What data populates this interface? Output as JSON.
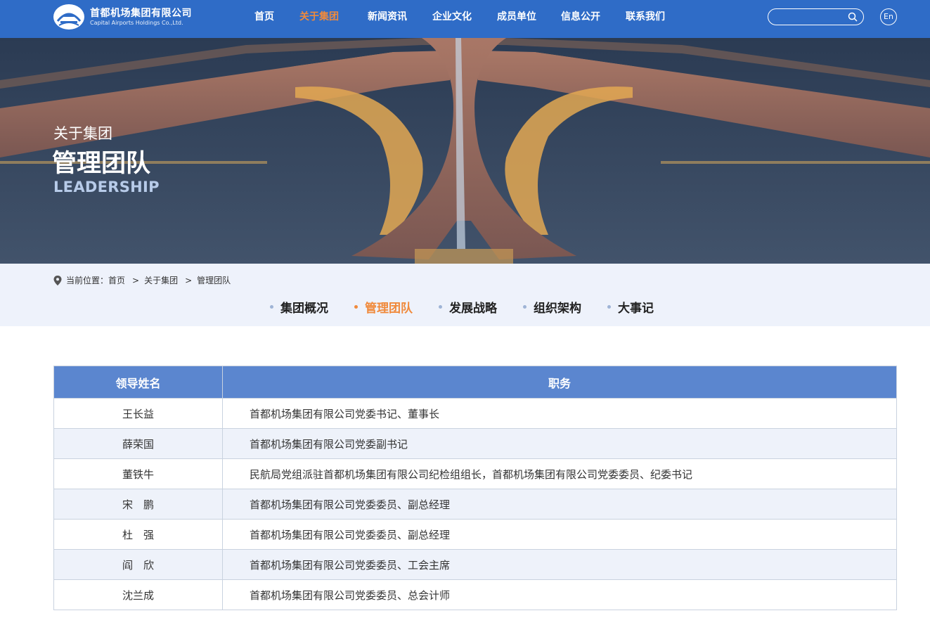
{
  "header": {
    "logo_cn": "首都机场集团有限公司",
    "logo_en": "Capital Airports Holdings Co.,Ltd.",
    "nav": [
      {
        "label": "首页",
        "active": false
      },
      {
        "label": "关于集团",
        "active": true
      },
      {
        "label": "新闻资讯",
        "active": false
      },
      {
        "label": "企业文化",
        "active": false
      },
      {
        "label": "成员单位",
        "active": false
      },
      {
        "label": "信息公开",
        "active": false
      },
      {
        "label": "联系我们",
        "active": false
      }
    ],
    "search_placeholder": "",
    "lang_label": "En"
  },
  "banner": {
    "subtitle": "关于集团",
    "title": "管理团队",
    "title_en": "LEADERSHIP"
  },
  "breadcrumb": {
    "prefix": "当前位置：",
    "items": [
      "首页",
      "关于集团",
      "管理团队"
    ]
  },
  "subnav": [
    {
      "label": "集团概况",
      "active": false
    },
    {
      "label": "管理团队",
      "active": true
    },
    {
      "label": "发展战略",
      "active": false
    },
    {
      "label": "组织架构",
      "active": false
    },
    {
      "label": "大事记",
      "active": false
    }
  ],
  "table": {
    "headers": [
      "领导姓名",
      "职务"
    ],
    "rows": [
      {
        "name": "王长益",
        "duty": "首都机场集团有限公司党委书记、董事长"
      },
      {
        "name": "薛荣国",
        "duty": "首都机场集团有限公司党委副书记"
      },
      {
        "name": "董铁牛",
        "duty": "民航局党组派驻首都机场集团有限公司纪检组组长，首都机场集团有限公司党委委员、纪委书记"
      },
      {
        "name": "宋　鹏",
        "duty": "首都机场集团有限公司党委委员、副总经理"
      },
      {
        "name": "杜　强",
        "duty": "首都机场集团有限公司党委委员、副总经理"
      },
      {
        "name": "阎　欣",
        "duty": "首都机场集团有限公司党委委员、工会主席"
      },
      {
        "name": "沈兰成",
        "duty": "首都机场集团有限公司党委委员、总会计师"
      }
    ]
  },
  "colors": {
    "header_bg": "#2f6cc7",
    "accent": "#f08a3c",
    "table_header_bg": "#5b86cf",
    "subbar_bg": "#eef2fb"
  }
}
